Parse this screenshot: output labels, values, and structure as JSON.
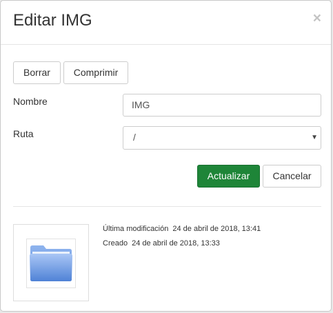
{
  "modal": {
    "title": "Editar IMG",
    "close_label": "×"
  },
  "toolbar": {
    "delete_label": "Borrar",
    "compress_label": "Comprimir"
  },
  "form": {
    "name_label": "Nombre",
    "name_value": "IMG",
    "path_label": "Ruta",
    "path_value": "/",
    "path_options": [
      "/"
    ]
  },
  "actions": {
    "update_label": "Actualizar",
    "cancel_label": "Cancelar"
  },
  "info": {
    "modified_label": "Última modificación",
    "modified_value": "24 de abril de 2018, 13:41",
    "created_label": "Creado",
    "created_value": "24 de abril de 2018, 13:33"
  },
  "thumbnail": {
    "icon": "folder-icon"
  },
  "colors": {
    "primary": "#1e8538",
    "folder": "#5b8fe0"
  }
}
